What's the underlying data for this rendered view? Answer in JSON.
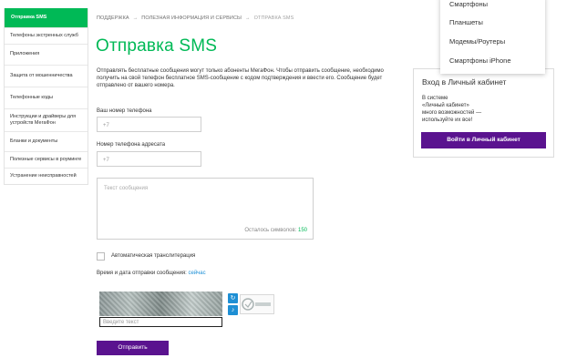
{
  "sidebar": {
    "items": [
      {
        "label": "Отправка SMS",
        "active": true
      },
      {
        "label": "Телефоны экстренных служб"
      },
      {
        "label": "Приложения"
      },
      {
        "label": "Защита от мошенничества"
      },
      {
        "label": "Телефонные коды"
      },
      {
        "label": "Инструкции и драйверы для устройств МегаФон"
      },
      {
        "label": "Бланки и документы"
      },
      {
        "label": "Полезные сервисы в роуминге"
      },
      {
        "label": "Устранение неисправностей"
      }
    ]
  },
  "breadcrumb": {
    "items": [
      "Поддержка",
      "Полезная информация и сервисы",
      "Отправка SMS"
    ],
    "separator": "→"
  },
  "page": {
    "title": "Отправка SMS",
    "intro": "Отправлять бесплатные сообщения могут только абоненты МегаФон. Чтобы отправить сообщение, необходимо получить на свой телефон бесплатное SMS-сообщение с кодом подтверждения и ввести его. Сообщение будет отправлено от вашего номера."
  },
  "form": {
    "sender_label": "Ваш номер телефона",
    "sender_placeholder": "+7",
    "recipient_label": "Номер телефона адресата",
    "recipient_placeholder": "+7",
    "message_placeholder": "Текст сообщения",
    "chars_left_label": "Осталось символов:",
    "chars_left_value": "150",
    "translit_label": "Автоматическая транслитерация",
    "translit_checked": false,
    "datetime_label": "Время и дата отправки сообщения:",
    "datetime_link": "сейчас",
    "captcha_placeholder": "Введите текст",
    "submit_label": "Отправить"
  },
  "login_panel": {
    "title": "Вход в Личный кабинет",
    "desc_line1": "В системе",
    "desc_line2": "«Личный кабинет»",
    "desc_line3": "много возможностей —",
    "desc_line4": "используйте их все!",
    "button_label": "Войти в Личный кабинет"
  },
  "dropdown": {
    "items": [
      "Смартфоны",
      "Планшеты",
      "Модемы/Роутеры",
      "Смартфоны iPhone"
    ]
  },
  "colors": {
    "accent_green": "#00b956",
    "accent_purple": "#5a138f",
    "link_blue": "#1a8ed6"
  },
  "icons": {
    "captcha_refresh": "refresh-icon",
    "captcha_audio": "audio-icon",
    "captcha_logo": "captcha-logo-icon"
  }
}
